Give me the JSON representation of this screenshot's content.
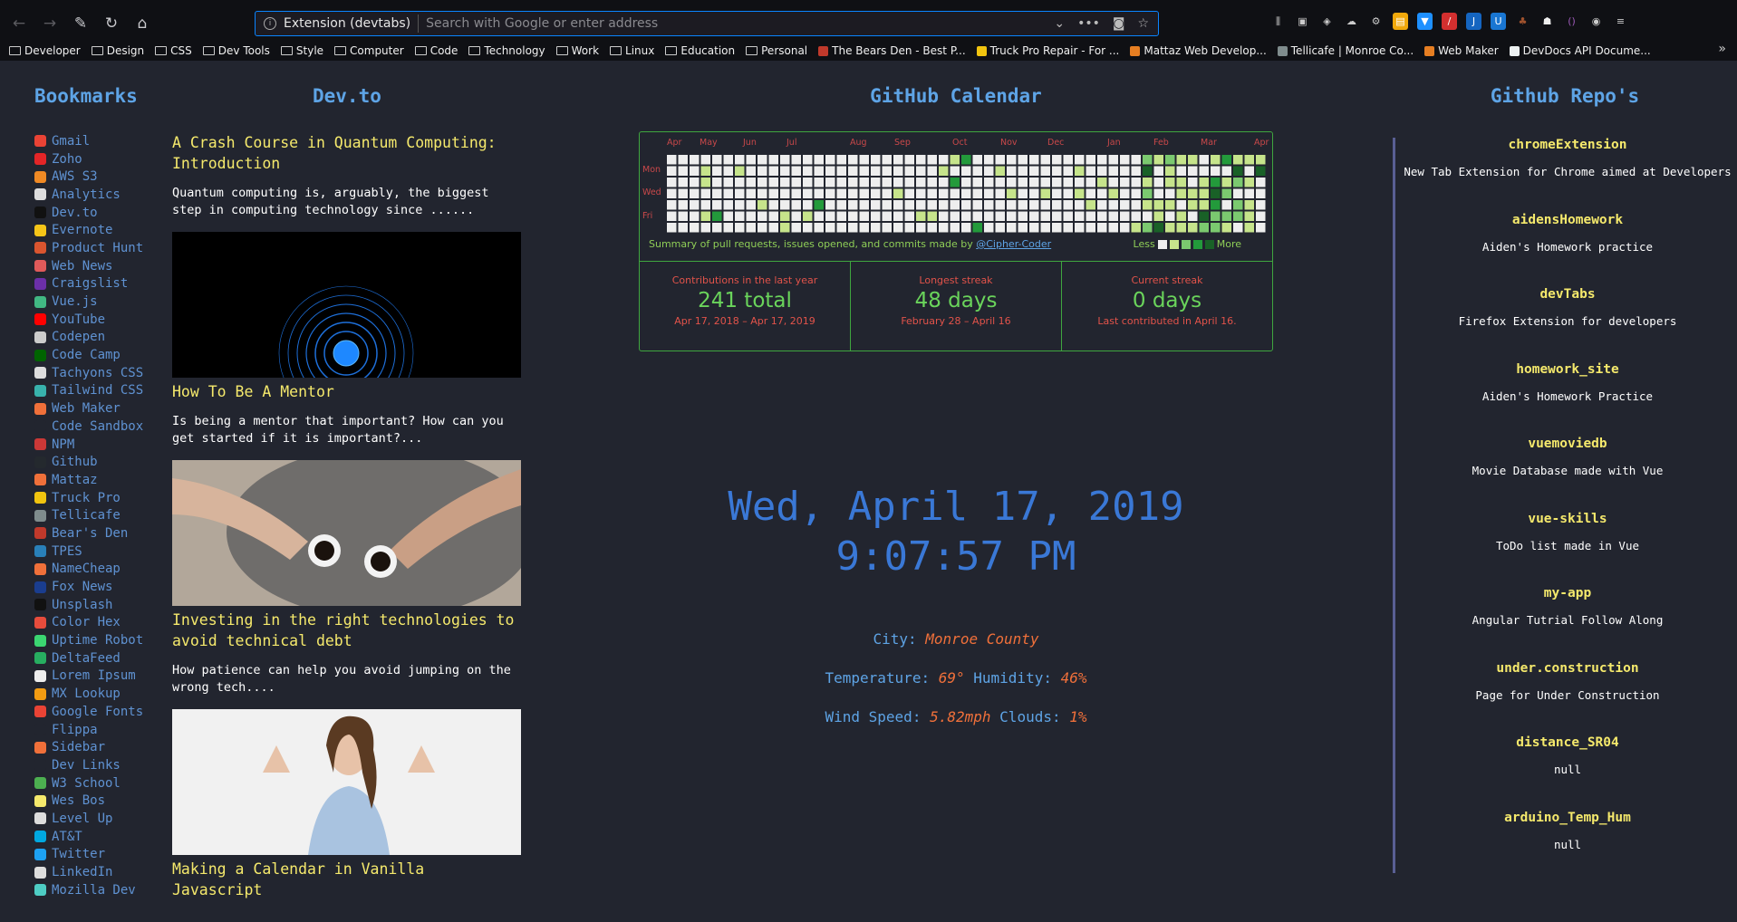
{
  "browser": {
    "extension_label": "Extension (devtabs)",
    "url_placeholder": "Search with Google or enter address",
    "bookmarks_bar": [
      {
        "label": "Developer",
        "type": "folder"
      },
      {
        "label": "Design",
        "type": "folder"
      },
      {
        "label": "CSS",
        "type": "folder"
      },
      {
        "label": "Dev Tools",
        "type": "folder"
      },
      {
        "label": "Style",
        "type": "folder"
      },
      {
        "label": "Computer",
        "type": "folder"
      },
      {
        "label": "Code",
        "type": "folder"
      },
      {
        "label": "Technology",
        "type": "folder"
      },
      {
        "label": "Work",
        "type": "folder"
      },
      {
        "label": "Linux",
        "type": "folder"
      },
      {
        "label": "Education",
        "type": "folder"
      },
      {
        "label": "Personal",
        "type": "folder"
      },
      {
        "label": "The Bears Den - Best P...",
        "type": "link",
        "color": "#c0392b"
      },
      {
        "label": "Truck Pro Repair - For ...",
        "type": "link",
        "color": "#f1c40f"
      },
      {
        "label": "Mattaz Web Develop...",
        "type": "link",
        "color": "#e67e22"
      },
      {
        "label": "Tellicafe | Monroe Co...",
        "type": "link",
        "color": "#7f8c8d"
      },
      {
        "label": "Web Maker",
        "type": "link",
        "color": "#e67e22"
      },
      {
        "label": "DevDocs API Docume...",
        "type": "link",
        "color": "#ecf0f1"
      }
    ]
  },
  "bookmarks": {
    "title": "Bookmarks",
    "items": [
      {
        "label": "Gmail",
        "color": "#ea4335"
      },
      {
        "label": "Zoho",
        "color": "#e42527"
      },
      {
        "label": "AWS S3",
        "color": "#f08a24"
      },
      {
        "label": "Analytics",
        "color": "#dddddd"
      },
      {
        "label": "Dev.to",
        "color": "#111111"
      },
      {
        "label": "Evernote",
        "color": "#f5c518"
      },
      {
        "label": "Product Hunt",
        "color": "#da552f"
      },
      {
        "label": "Web News",
        "color": "#e05a5a"
      },
      {
        "label": "Craigslist",
        "color": "#6b2fa8"
      },
      {
        "label": "Vue.js",
        "color": "#41b883"
      },
      {
        "label": "YouTube",
        "color": "#ff0000"
      },
      {
        "label": "Codepen",
        "color": "#cccccc"
      },
      {
        "label": "Code Camp",
        "color": "#006400"
      },
      {
        "label": "Tachyons CSS",
        "color": "#dddddd"
      },
      {
        "label": "Tailwind CSS",
        "color": "#38b2ac"
      },
      {
        "label": "Web Maker",
        "color": "#f0703a"
      },
      {
        "label": "Code Sandbox",
        "color": "#22252f"
      },
      {
        "label": "NPM",
        "color": "#cb3837"
      },
      {
        "label": "Github",
        "color": "#24292e"
      },
      {
        "label": "Mattaz",
        "color": "#f0703a"
      },
      {
        "label": "Truck Pro",
        "color": "#f1c40f"
      },
      {
        "label": "Tellicafe",
        "color": "#7f8c8d"
      },
      {
        "label": "Bear's Den",
        "color": "#c0392b"
      },
      {
        "label": "TPES",
        "color": "#2980b9"
      },
      {
        "label": "NameCheap",
        "color": "#f0703a"
      },
      {
        "label": "Fox News",
        "color": "#1a3d8f"
      },
      {
        "label": "Unsplash",
        "color": "#111111"
      },
      {
        "label": "Color Hex",
        "color": "#e74c3c"
      },
      {
        "label": "Uptime Robot",
        "color": "#3bd671"
      },
      {
        "label": "DeltaFeed",
        "color": "#27ae60"
      },
      {
        "label": "Lorem Ipsum",
        "color": "#eeeeee"
      },
      {
        "label": "MX Lookup",
        "color": "#f39c12"
      },
      {
        "label": "Google Fonts",
        "color": "#ea4335"
      },
      {
        "label": "Flippa",
        "color": "#22252f"
      },
      {
        "label": "Sidebar",
        "color": "#f0703a"
      },
      {
        "label": "Dev Links",
        "color": "#22252f"
      },
      {
        "label": "W3 School",
        "color": "#4caf50"
      },
      {
        "label": "Wes Bos",
        "color": "#f5e96c"
      },
      {
        "label": "Level Up",
        "color": "#dddddd"
      },
      {
        "label": "AT&T",
        "color": "#00a8e0"
      },
      {
        "label": "Twitter",
        "color": "#1da1f2"
      },
      {
        "label": "LinkedIn",
        "color": "#dddddd"
      },
      {
        "label": "Mozilla Dev",
        "color": "#4ecdc4"
      }
    ]
  },
  "devto": {
    "title": "Dev.to",
    "articles": [
      {
        "title": "A Crash Course in Quantum Computing: Introduction",
        "desc": "Quantum computing is, arguably, the biggest step in computing technology since ......"
      },
      {
        "title": "How To Be A Mentor",
        "desc": "Is being a mentor that important? How can you get started if it is important?..."
      },
      {
        "title": "Investing in the right technologies to avoid technical debt",
        "desc": "How patience can help you avoid jumping on the wrong tech...."
      },
      {
        "title": "Making a Calendar in Vanilla Javascript",
        "desc": ""
      }
    ]
  },
  "calendar": {
    "title": "GitHub Calendar",
    "months": [
      "Apr",
      "May",
      "Jun",
      "Jul",
      "Aug",
      "Sep",
      "Oct",
      "Nov",
      "Dec",
      "Jan",
      "Feb",
      "Mar",
      "Apr"
    ],
    "days": [
      "Mon",
      "Wed",
      "Fri"
    ],
    "summary_prefix": "Summary of pull requests, issues opened, and commits made by ",
    "summary_user": "@Cipher-Coder",
    "legend_less": "Less",
    "legend_more": "More",
    "colors": [
      "#eeeeee",
      "#c6e48b",
      "#7bc96f",
      "#239a3b",
      "#196127"
    ],
    "stats": [
      {
        "label": "Contributions in the last year",
        "value": "241 total",
        "sub": "Apr 17, 2018 – Apr 17, 2019"
      },
      {
        "label": "Longest streak",
        "value": "48 days",
        "sub": "February 28 – April 16"
      },
      {
        "label": "Current streak",
        "value": "0 days",
        "sub": "Last contributed in April 16."
      }
    ]
  },
  "clock": {
    "text": "Wed, April 17, 2019 9:07:57 PM"
  },
  "weather": {
    "city_label": "City:",
    "city": "Monroe County",
    "temp_label": "Temperature:",
    "temp": "69°",
    "humidity_label": "Humidity:",
    "humidity": "46%",
    "wind_label": "Wind Speed:",
    "wind": "5.82mph",
    "clouds_label": "Clouds:",
    "clouds": "1%"
  },
  "repos": {
    "title": "Github Repo's",
    "items": [
      {
        "name": "chromeExtension",
        "desc": "New Tab Extension for Chrome aimed at Developers"
      },
      {
        "name": "aidensHomework",
        "desc": "Aiden's Homework practice"
      },
      {
        "name": "devTabs",
        "desc": "Firefox Extension for developers"
      },
      {
        "name": "homework_site",
        "desc": "Aiden's Homework Practice"
      },
      {
        "name": "vuemoviedb",
        "desc": "Movie Database made with Vue"
      },
      {
        "name": "vue-skills",
        "desc": "ToDo list made in Vue"
      },
      {
        "name": "my-app",
        "desc": "Angular Tutrial Follow Along"
      },
      {
        "name": "under.construction",
        "desc": "Page for Under Construction"
      },
      {
        "name": "distance_SR04",
        "desc": "null"
      },
      {
        "name": "arduino_Temp_Hum",
        "desc": "null"
      }
    ]
  }
}
